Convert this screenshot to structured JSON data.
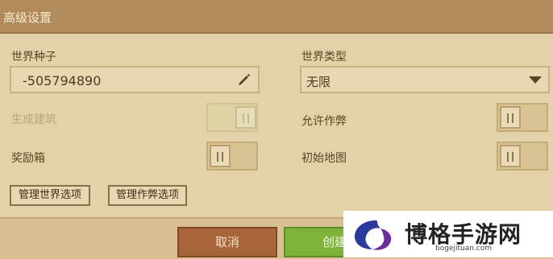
{
  "window": {
    "title": "高级设置"
  },
  "seed": {
    "label": "世界种子",
    "value": "-505794890",
    "edit_icon": "pencil-icon"
  },
  "world_type": {
    "label": "世界类型",
    "selected": "无限",
    "dropdown_icon": "caret-down-icon"
  },
  "toggles": {
    "generate_structures": {
      "label": "生成建筑",
      "enabled": false,
      "on": true
    },
    "allow_cheats": {
      "label": "允许作弊",
      "enabled": true,
      "on": false
    },
    "bonus_chest": {
      "label": "奖励箱",
      "enabled": true,
      "on": false
    },
    "starting_map": {
      "label": "初始地图",
      "enabled": true,
      "on": false
    }
  },
  "buttons": {
    "manage_world": "管理世界选项",
    "manage_cheats": "管理作弊选项",
    "cancel": "取消",
    "create": "创建"
  },
  "watermark": {
    "title": "博格手游网",
    "subtitle": "bogejituan.com"
  },
  "colors": {
    "header": "#b38a5c",
    "panel": "#e3d1a8",
    "cancel": "#a8653a",
    "create": "#7fb33a"
  }
}
